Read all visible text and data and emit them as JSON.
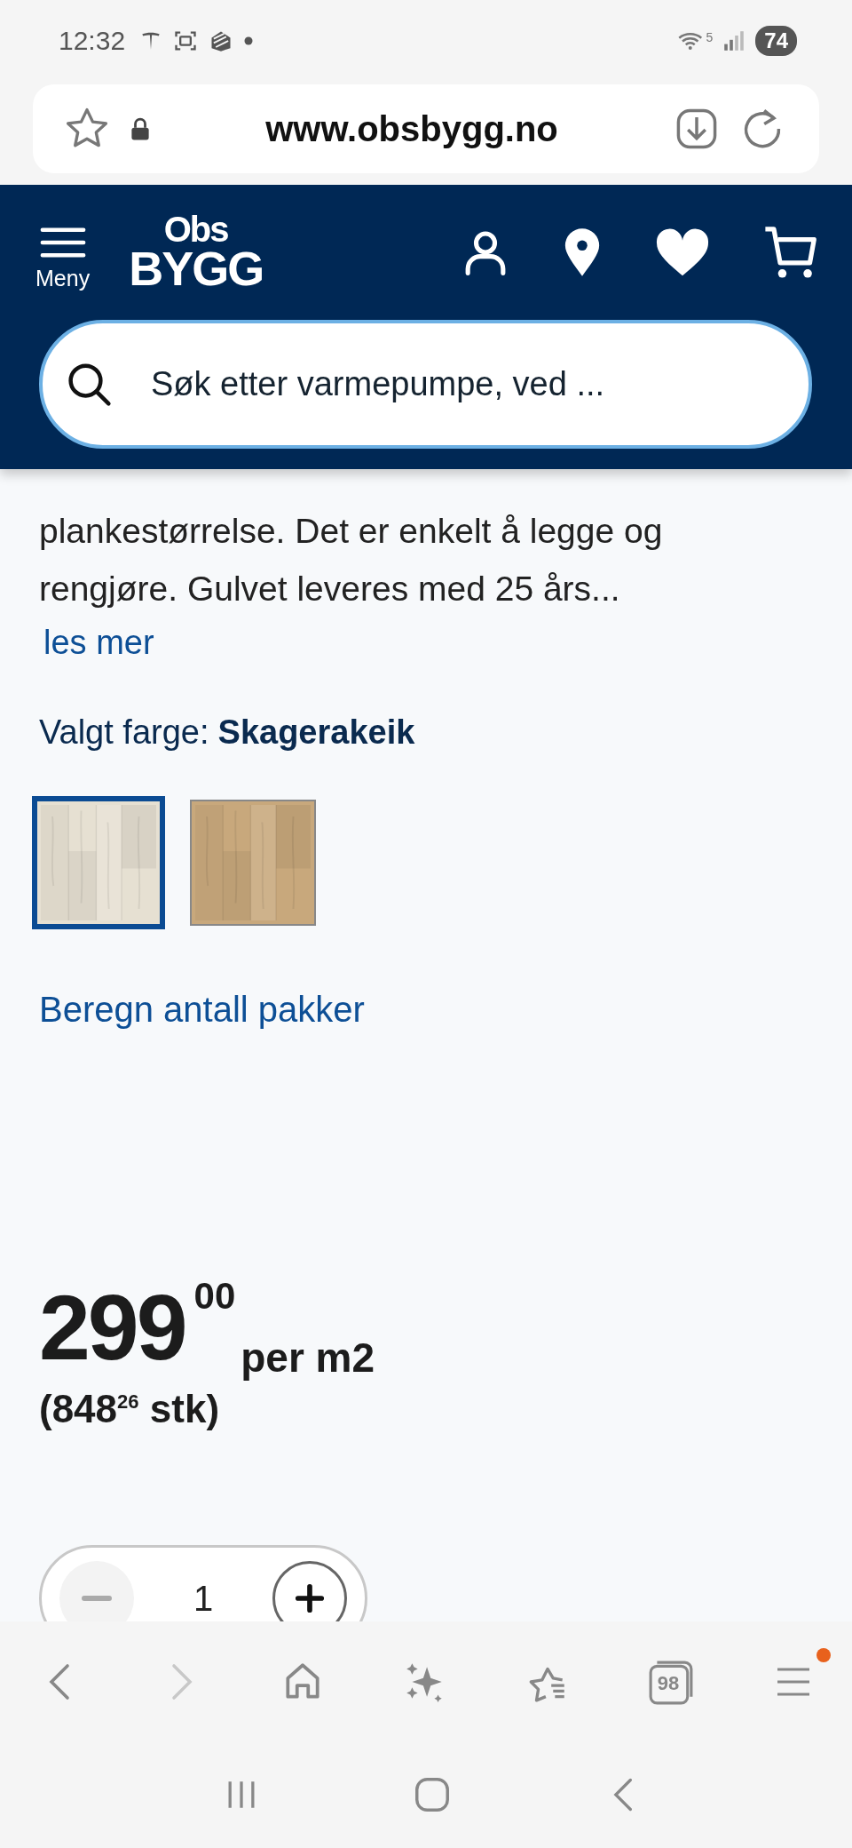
{
  "status_bar": {
    "time": "12:32",
    "wifi_label": "5",
    "battery": "74"
  },
  "address_bar": {
    "url": "www.obsbygg.no"
  },
  "header": {
    "menu_label": "Meny",
    "logo_top": "Obs",
    "logo_bottom": "BYGG"
  },
  "search": {
    "placeholder": "Søk etter varmepumpe, ved ..."
  },
  "description": "plankestørrelse. Det er enkelt å legge og rengjøre. Gulvet leveres med 25 års...",
  "read_more": "les mer",
  "chosen_color": {
    "label": "Valgt farge:",
    "value": "Skagerakeik"
  },
  "swatches": [
    {
      "selected": true,
      "color": "#e6e0d2"
    },
    {
      "selected": false,
      "color": "#c8a87c"
    }
  ],
  "calculate_link": "Beregn antall pakker",
  "price": {
    "whole": "299",
    "cents": "00",
    "unit": "per m2",
    "per_piece": "(848$^{26}$ stk)"
  },
  "quantity": {
    "value": "1",
    "decrement_disabled": true
  },
  "browser_toolbar": {
    "forward_disabled": true,
    "tab_count": "98",
    "menu_badge": true
  }
}
